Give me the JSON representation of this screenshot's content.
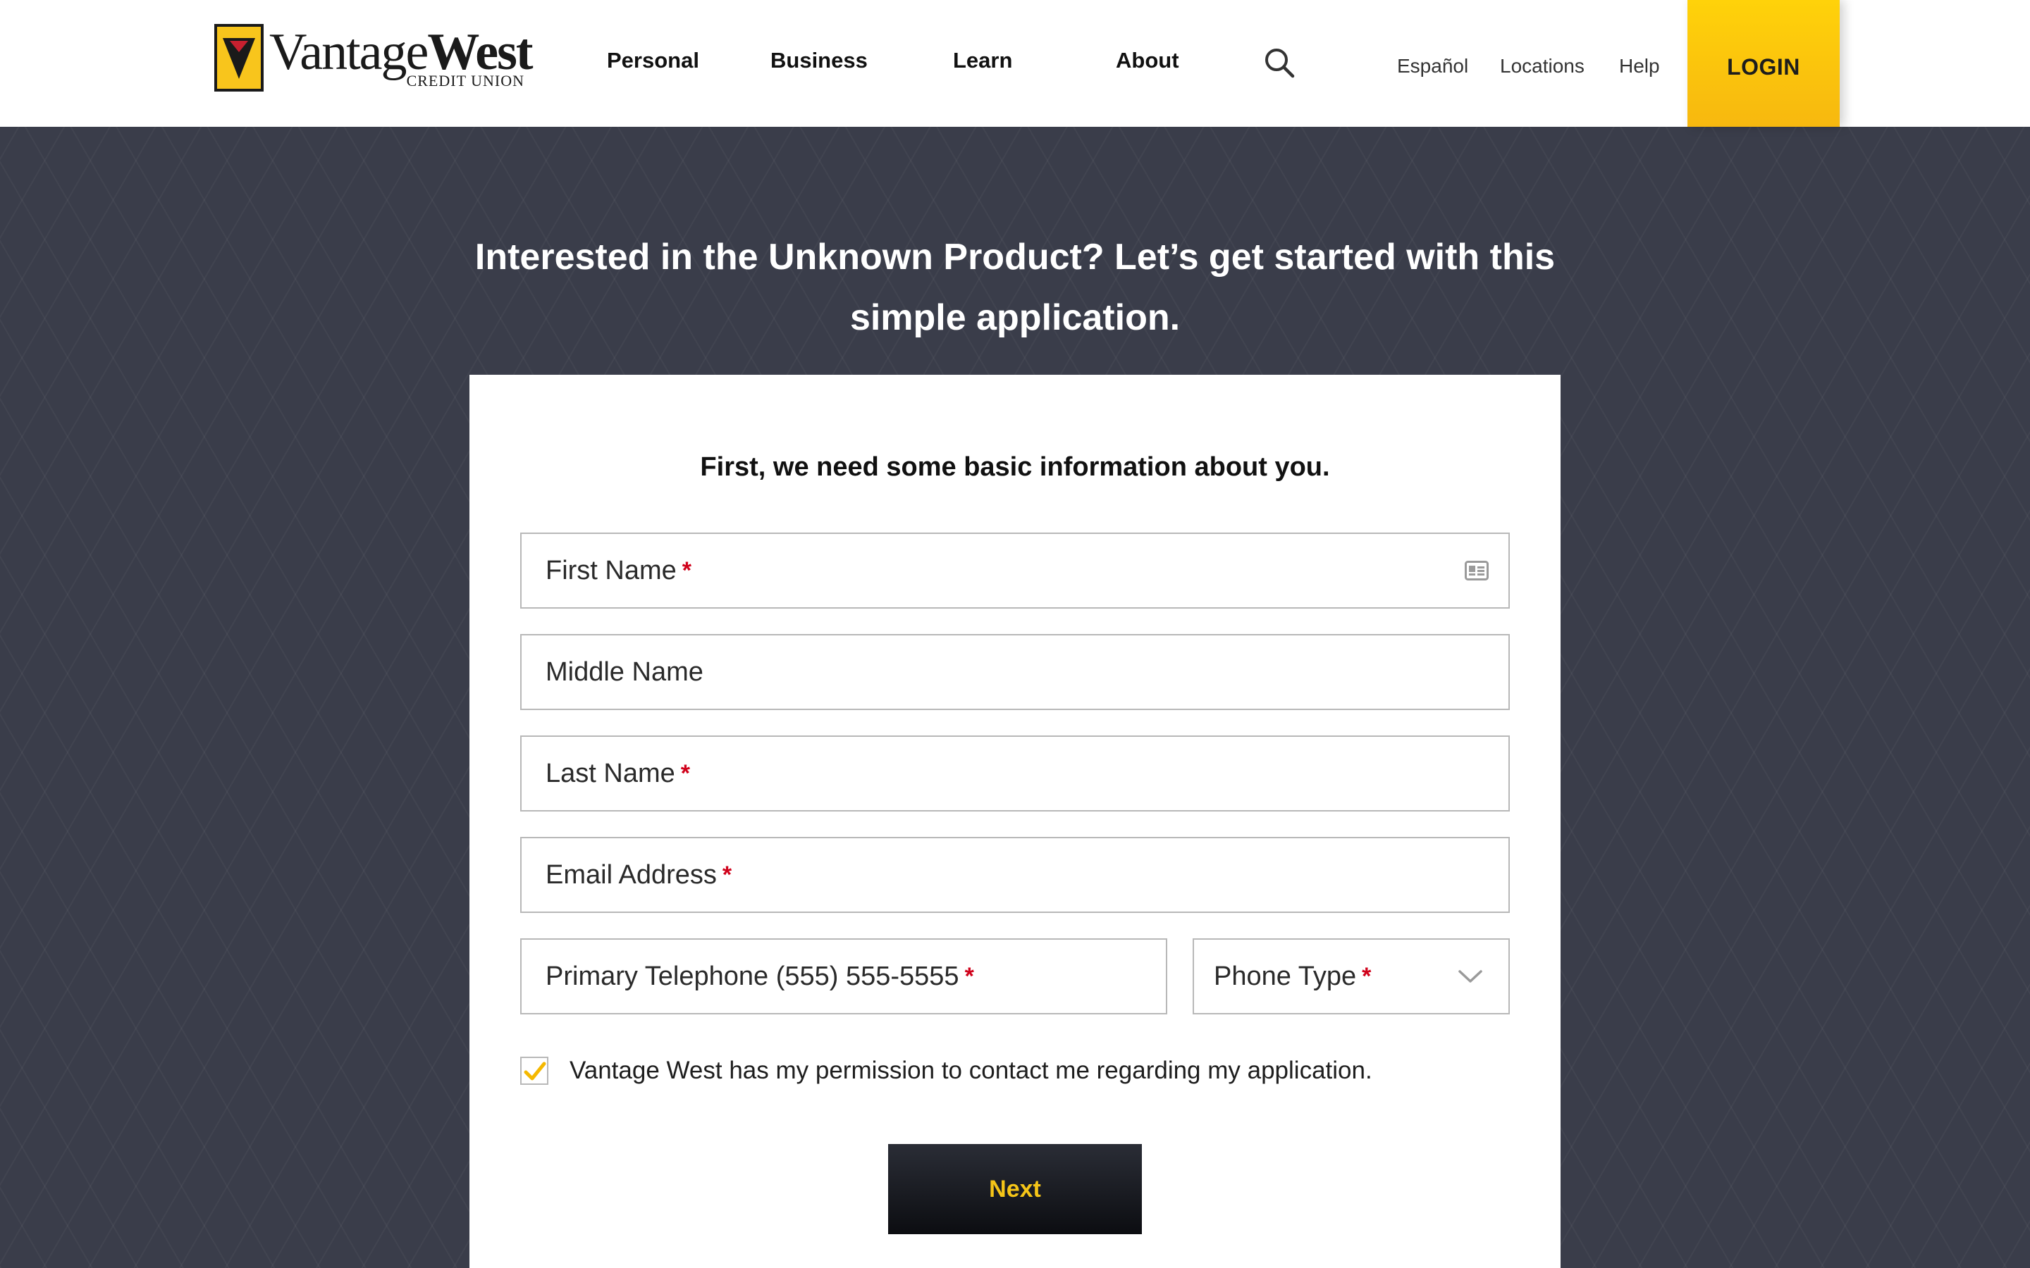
{
  "brand": {
    "name_light": "Vantage",
    "name_bold": "West",
    "tagline": "CREDIT UNION",
    "colors": {
      "accent": "#f8c51c",
      "logo_red": "#c8202f",
      "dark": "#1a1a1a",
      "required": "#d0021b"
    }
  },
  "nav": {
    "items": [
      {
        "label": "Personal"
      },
      {
        "label": "Business"
      },
      {
        "label": "Learn"
      },
      {
        "label": "About"
      }
    ],
    "search_icon": "search-icon"
  },
  "utility": {
    "links": [
      {
        "label": "Español"
      },
      {
        "label": "Locations"
      },
      {
        "label": "Help"
      }
    ],
    "login_label": "LOGIN"
  },
  "hero": {
    "title": "Interested in the Unknown Product? Let’s get started with this simple application."
  },
  "form": {
    "heading": "First, we need some basic information about you.",
    "fields": {
      "first_name": {
        "label": "First Name",
        "required_mark": "*",
        "value": ""
      },
      "middle_name": {
        "label": "Middle Name",
        "value": ""
      },
      "last_name": {
        "label": "Last Name",
        "required_mark": "*",
        "value": ""
      },
      "email": {
        "label": "Email Address",
        "required_mark": "*",
        "value": ""
      },
      "phone": {
        "label": "Primary Telephone (555) 555-5555",
        "required_mark": "*",
        "value": ""
      },
      "phone_type": {
        "label": "Phone Type",
        "required_mark": "*",
        "selected": ""
      }
    },
    "consent": {
      "checked": true,
      "label": "Vantage West has my permission to contact me regarding my application."
    },
    "next_label": "Next"
  }
}
